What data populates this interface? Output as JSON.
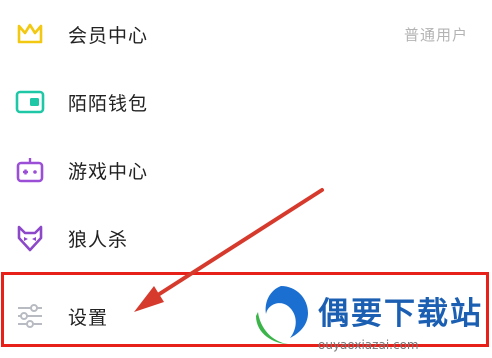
{
  "menu": {
    "items": [
      {
        "label": "会员中心",
        "icon": "crown-icon",
        "right": "普通用户",
        "color": "#f2c811"
      },
      {
        "label": "陌陌钱包",
        "icon": "wallet-icon",
        "color": "#1ec7a5"
      },
      {
        "label": "游戏中心",
        "icon": "gamepad-icon",
        "color": "#9b4fd6"
      },
      {
        "label": "狼人杀",
        "icon": "wolf-icon",
        "color": "#8d48c9"
      },
      {
        "label": "设置",
        "icon": "sliders-icon",
        "color": "#b8bcc2"
      }
    ]
  },
  "annotation": {
    "box_color": "#e8201a",
    "arrow_color": "#d63a2c"
  },
  "watermark": {
    "brand": "偶要下载站",
    "url": "ouyaoxiazai.com"
  }
}
